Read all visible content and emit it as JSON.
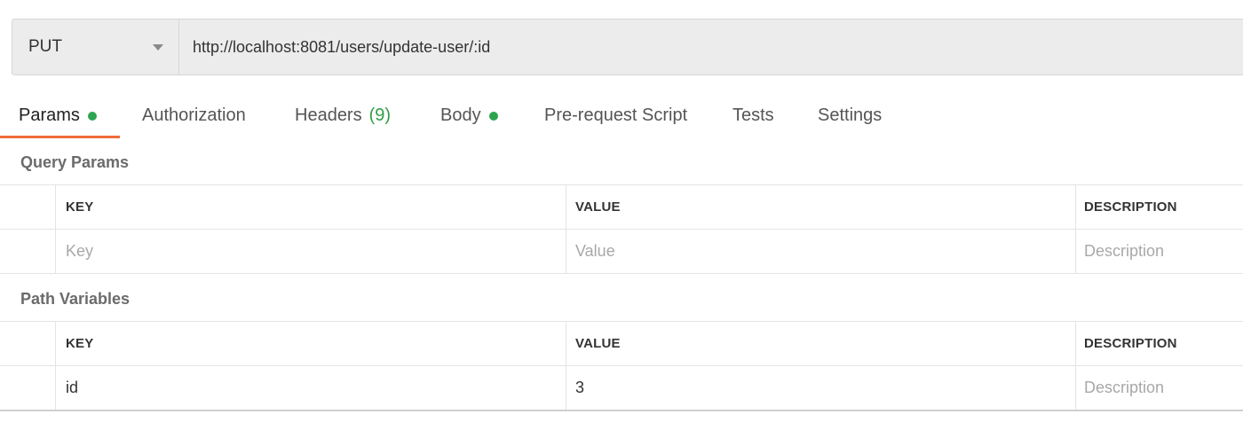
{
  "request": {
    "method": "PUT",
    "url": "http://localhost:8081/users/update-user/:id"
  },
  "tabs": [
    {
      "label": "Params",
      "dot": true,
      "active": true
    },
    {
      "label": "Authorization"
    },
    {
      "label": "Headers",
      "count": "(9)"
    },
    {
      "label": "Body",
      "dot": true
    },
    {
      "label": "Pre-request Script"
    },
    {
      "label": "Tests"
    },
    {
      "label": "Settings"
    }
  ],
  "query_params": {
    "title": "Query Params",
    "headers": {
      "key": "KEY",
      "value": "VALUE",
      "description": "DESCRIPTION"
    },
    "empty_row": {
      "key_placeholder": "Key",
      "value_placeholder": "Value",
      "description_placeholder": "Description"
    }
  },
  "path_variables": {
    "title": "Path Variables",
    "headers": {
      "key": "KEY",
      "value": "VALUE",
      "description": "DESCRIPTION"
    },
    "rows": [
      {
        "key": "id",
        "value": "3",
        "description_placeholder": "Description"
      }
    ]
  },
  "colors": {
    "active_tab_underline": "#f26b3a",
    "status_dot": "#2ea44f",
    "headers_count": "#2f9e44"
  }
}
